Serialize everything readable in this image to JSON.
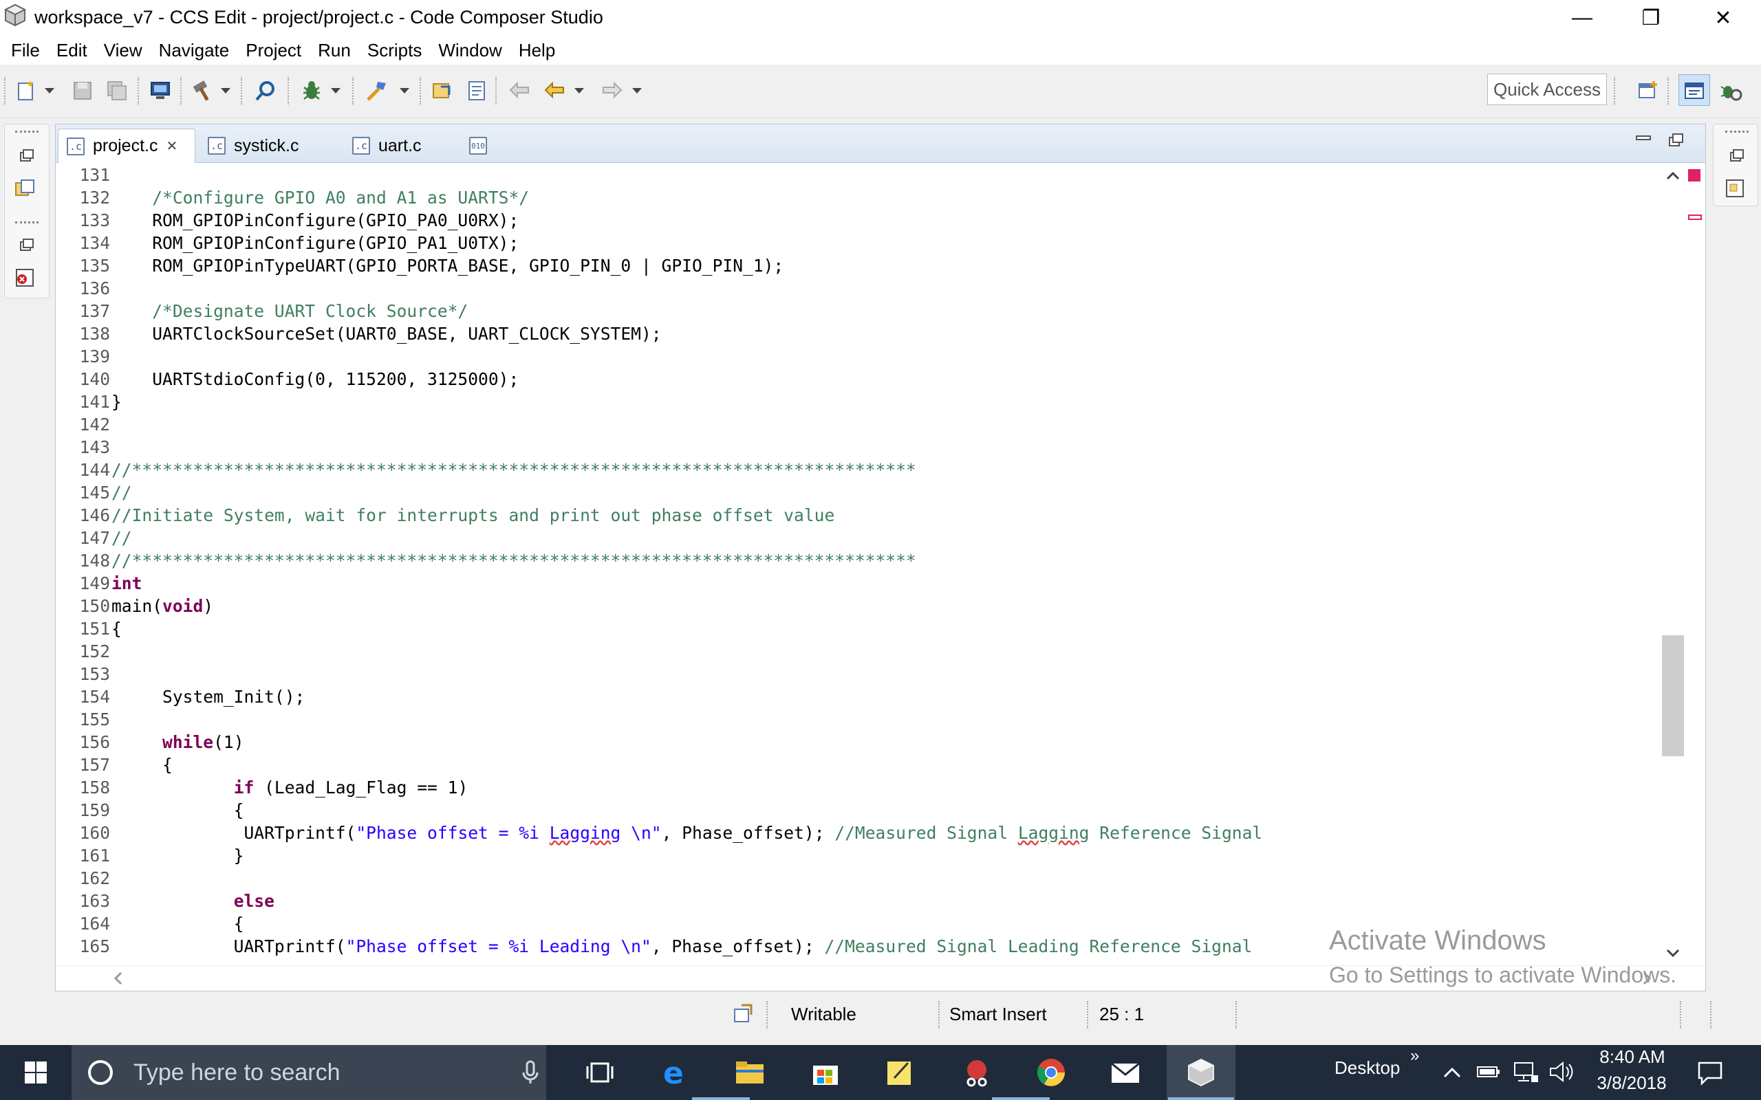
{
  "window": {
    "title": "workspace_v7 - CCS Edit - project/project.c - Code Composer Studio",
    "minimize_glyph": "—",
    "restore_glyph": "❐",
    "close_glyph": "✕"
  },
  "menu": [
    "File",
    "Edit",
    "View",
    "Navigate",
    "Project",
    "Run",
    "Scripts",
    "Window",
    "Help"
  ],
  "toolbar": {
    "quick_access": "Quick Access",
    "icons": [
      "new-icon",
      "save-icon",
      "save-all-icon",
      "debug-config-icon",
      "build-hammer-icon",
      "search-icon",
      "debug-bug-icon",
      "flash-icon",
      "open-type-icon",
      "open-resource-icon",
      "last-edit-icon",
      "back-arrow-icon",
      "forward-arrow-icon"
    ]
  },
  "tabs": [
    {
      "label": "project.c",
      "active": true,
      "icon": "c-file-icon",
      "close": "✕"
    },
    {
      "label": "systick.c",
      "active": false,
      "icon": "c-file-icon"
    },
    {
      "label": "uart.c",
      "active": false,
      "icon": "c-file-icon"
    },
    {
      "label": "",
      "active": false,
      "icon": "binary-file-icon",
      "icon_text": "010"
    }
  ],
  "code": [
    {
      "n": "131",
      "t": ""
    },
    {
      "n": "132",
      "t": "    /*Configure GPIO A0 and A1 as UARTS*/"
    },
    {
      "n": "133",
      "t": "    ROM_GPIOPinConfigure(GPIO_PA0_U0RX);"
    },
    {
      "n": "134",
      "t": "    ROM_GPIOPinConfigure(GPIO_PA1_U0TX);"
    },
    {
      "n": "135",
      "t": "    ROM_GPIOPinTypeUART(GPIO_PORTA_BASE, GPIO_PIN_0 | GPIO_PIN_1);"
    },
    {
      "n": "136",
      "t": ""
    },
    {
      "n": "137",
      "t": "    /*Designate UART Clock Source*/"
    },
    {
      "n": "138",
      "t": "    UARTClockSourceSet(UART0_BASE, UART_CLOCK_SYSTEM);"
    },
    {
      "n": "139",
      "t": ""
    },
    {
      "n": "140",
      "t": "    UARTStdioConfig(0, 115200, 3125000);"
    },
    {
      "n": "141",
      "t": "}"
    },
    {
      "n": "142",
      "t": ""
    },
    {
      "n": "143",
      "t": ""
    },
    {
      "n": "144",
      "t": "//*****************************************************************************"
    },
    {
      "n": "145",
      "t": "//"
    },
    {
      "n": "146",
      "t": "//Initiate System, wait for interrupts and print out phase offset value"
    },
    {
      "n": "147",
      "t": "//"
    },
    {
      "n": "148",
      "t": "//*****************************************************************************"
    },
    {
      "n": "149",
      "t": "int"
    },
    {
      "n": "150",
      "t": "main(void)"
    },
    {
      "n": "151",
      "t": "{"
    },
    {
      "n": "152",
      "t": ""
    },
    {
      "n": "153",
      "t": ""
    },
    {
      "n": "154",
      "t": "     System_Init();"
    },
    {
      "n": "155",
      "t": ""
    },
    {
      "n": "156",
      "t": "     while(1)"
    },
    {
      "n": "157",
      "t": "     {"
    },
    {
      "n": "158",
      "t": "            if (Lead_Lag_Flag == 1)"
    },
    {
      "n": "159",
      "t": "            {"
    },
    {
      "n": "160",
      "t": "             UARTprintf(\"Phase offset = %i Lagging \\n\", Phase_offset); //Measured Signal Lagging Reference Signal"
    },
    {
      "n": "161",
      "t": "            }"
    },
    {
      "n": "162",
      "t": ""
    },
    {
      "n": "163",
      "t": "            else"
    },
    {
      "n": "164",
      "t": "            {"
    },
    {
      "n": "165",
      "t": "            UARTprintf(\"Phase offset = %i Leading \\n\", Phase_offset); //Measured Signal Leading Reference Signal"
    }
  ],
  "status": {
    "writable": "Writable",
    "insert_mode": "Smart Insert",
    "position": "25 : 1"
  },
  "watermark": {
    "line1": "Activate Windows",
    "line2": "Go to Settings to activate Windows."
  },
  "taskbar": {
    "search_placeholder": "Type here to search",
    "desktop_label": "Desktop",
    "time": "8:40 AM",
    "date": "3/8/2018"
  },
  "colors": {
    "comment": "#3f7f5f",
    "keyword": "#7f0055",
    "string": "#2a00ff",
    "taskbar": "#1f2b3a"
  }
}
